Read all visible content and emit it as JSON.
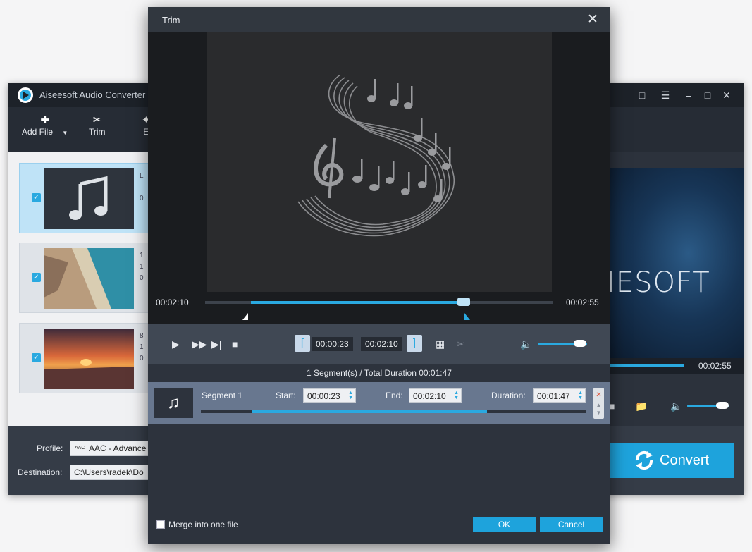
{
  "main_window": {
    "title": "Aiseesoft Audio Converter",
    "toolbar": {
      "add_file_label": "Add File",
      "trim_label": "Trim",
      "edit_label": "E"
    },
    "files": [
      {
        "name": "L",
        "line2": "0"
      },
      {
        "name": "1",
        "line2": "1",
        "line3": "0"
      },
      {
        "name": "8",
        "line2": "1",
        "line3": "0"
      }
    ],
    "preview": {
      "brand_text": "IESOFT",
      "time": "00:02:55"
    },
    "profile_label": "Profile:",
    "profile_value": "AAC - Advance",
    "destination_label": "Destination:",
    "destination_value": "C:\\Users\\radek\\Do",
    "convert_label": "Convert"
  },
  "trim": {
    "title": "Trim",
    "current_time": "00:02:10",
    "total_time": "00:02:55",
    "start_time": "00:00:23",
    "end_time": "00:02:10",
    "summary": "1 Segment(s) / Total Duration 00:01:47",
    "segment": {
      "name": "Segment 1",
      "start_label": "Start:",
      "start_value": "00:00:23",
      "end_label": "End:",
      "end_value": "00:02:10",
      "duration_label": "Duration:",
      "duration_value": "00:01:47"
    },
    "merge_label": "Merge into one file",
    "ok_label": "OK",
    "cancel_label": "Cancel",
    "volume_level": 0.85
  },
  "colors": {
    "accent": "#2aa9e0",
    "dialog_bg": "#2d333d",
    "segment_row": "#68778f"
  }
}
